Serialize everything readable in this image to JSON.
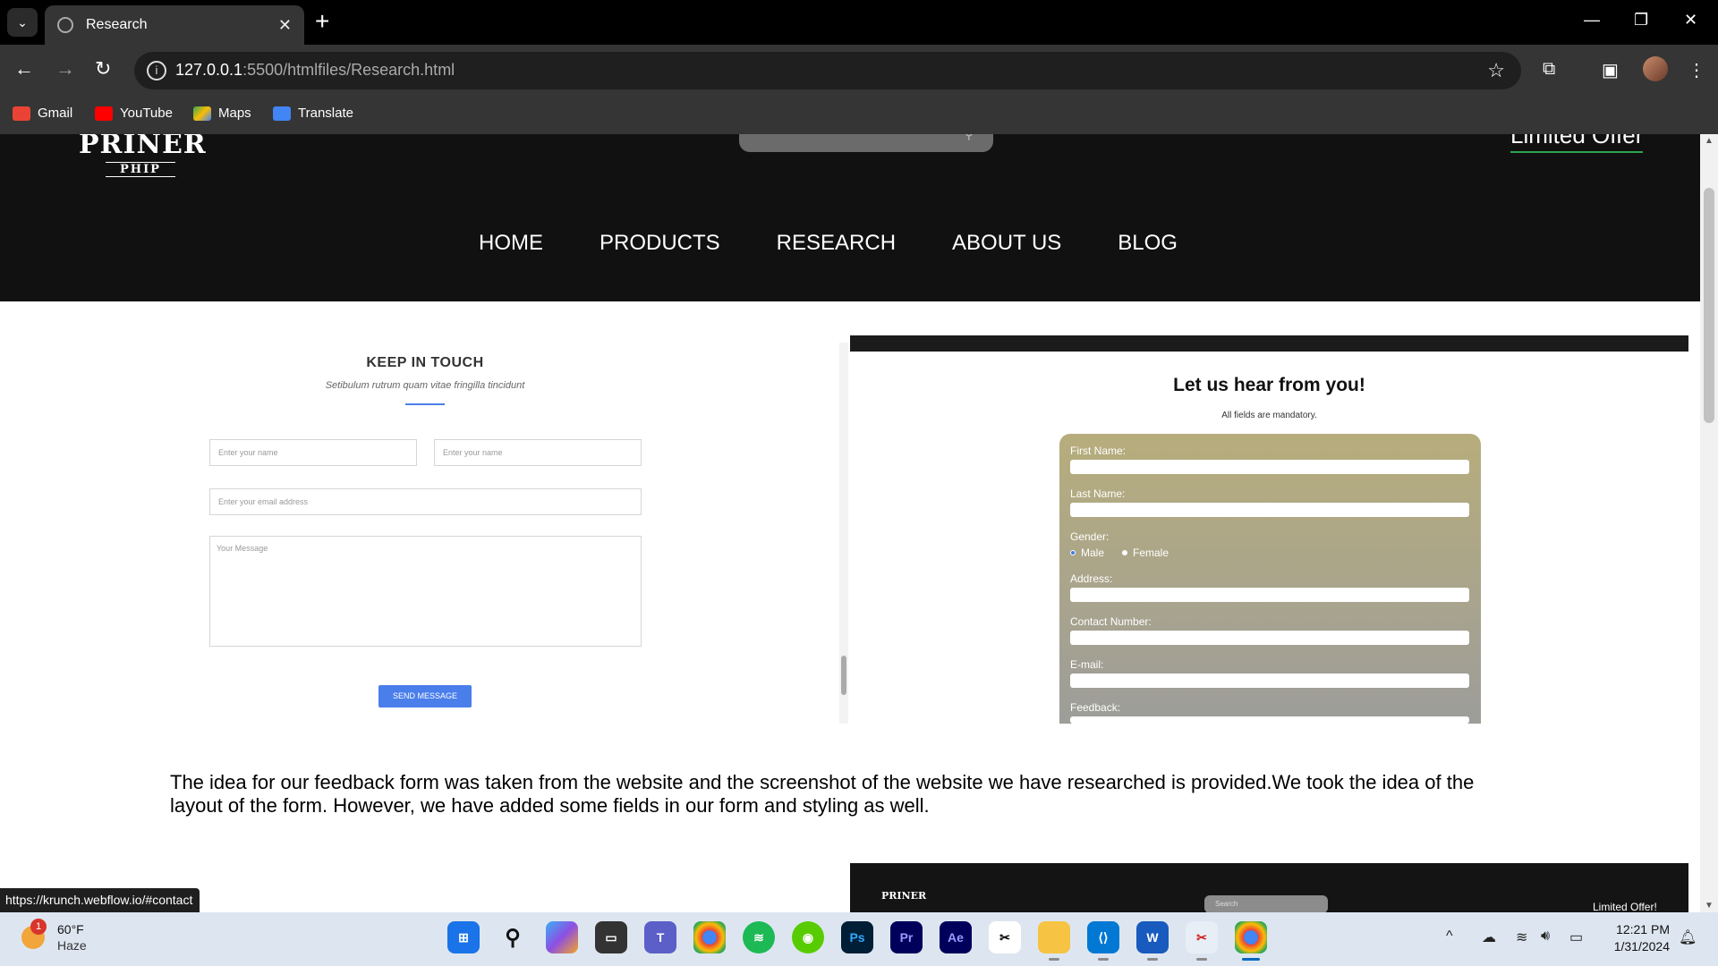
{
  "browser": {
    "tab_title": "Research",
    "tab_close": "✕",
    "new_tab": "+",
    "url_host": "127.0.0.1",
    "url_path": ":5500/htmlfiles/Research.html",
    "bookmarks": [
      "Gmail",
      "YouTube",
      "Maps",
      "Translate"
    ]
  },
  "site": {
    "logo_main": "PRINER",
    "logo_sub": "PHIP",
    "offer": "Limited Offer",
    "nav": [
      "HOME",
      "PRODUCTS",
      "RESEARCH",
      "ABOUT US",
      "BLOG"
    ]
  },
  "contact": {
    "title": "KEEP IN TOUCH",
    "subtitle": "Setibulum rutrum quam vitae fringilla tincidunt",
    "name1_placeholder": "Enter your name",
    "name2_placeholder": "Enter your name",
    "email_placeholder": "Enter your email address",
    "message_placeholder": "Your Message",
    "send_label": "SEND MESSAGE"
  },
  "feedback_shot": {
    "title": "Let us hear from you!",
    "mandatory": "All fields are mandatory.",
    "labels": [
      "First Name:",
      "Last Name:",
      "Gender:",
      "Address:",
      "Contact Number:",
      "E-mail:",
      "Feedback:"
    ],
    "gender_options": [
      "Male",
      "Female"
    ]
  },
  "paragraph": "The idea for our feedback form was taken from the website and the screenshot of the website we have researched is provided.We took the idea of the layout of the form. However, we have added some fields in our form and styling as well.",
  "shot2": {
    "logo": "PRINER",
    "search": "Search",
    "offer": "Limited Offer!"
  },
  "status_url": "https://krunch.webflow.io/#contact",
  "taskbar": {
    "temp": "60°F",
    "condition": "Haze",
    "badge": "1",
    "time": "12:21 PM",
    "date": "1/31/2024"
  }
}
